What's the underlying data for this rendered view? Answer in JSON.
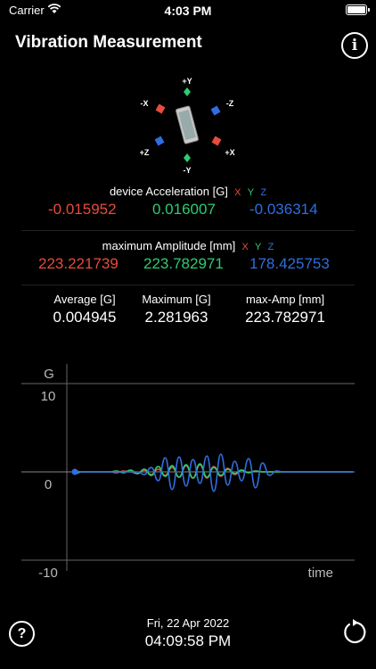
{
  "status_bar": {
    "carrier": "Carrier",
    "time": "4:03 PM"
  },
  "header": {
    "title": "Vibration Measurement",
    "info_icon": "info-icon"
  },
  "orientation": {
    "labels": {
      "py": "+Y",
      "ny": "-Y",
      "px": "+X",
      "nx": "-X",
      "pz": "+Z",
      "nz": "-Z"
    }
  },
  "acceleration": {
    "label": "device Acceleration [G]",
    "axes": {
      "x": "X",
      "y": "Y",
      "z": "Z"
    },
    "x": "-0.015952",
    "y": "0.016007",
    "z": "-0.036314"
  },
  "amplitude": {
    "label": "maximum Amplitude [mm]",
    "axes": {
      "x": "X",
      "y": "Y",
      "z": "Z"
    },
    "x": "223.221739",
    "y": "223.782971",
    "z": "178.425753"
  },
  "stats": {
    "average": {
      "label": "Average [G]",
      "value": "0.004945"
    },
    "maximum": {
      "label": "Maximum [G]",
      "value": "2.281963"
    },
    "max_amp": {
      "label": "max-Amp [mm]",
      "value": "223.782971"
    }
  },
  "chart_data": {
    "type": "line",
    "ylabel": "G",
    "xlabel": "time",
    "ylim": [
      -10,
      10
    ],
    "ytick_labels": [
      "10",
      "0",
      "-10"
    ],
    "colors": {
      "x": "#e74c3c",
      "y": "#2ecc71",
      "z": "#2f6ee0"
    },
    "x": [
      0,
      1,
      2,
      3,
      4,
      5,
      6,
      7,
      8,
      9,
      10,
      11,
      12,
      13,
      14,
      15,
      16,
      17,
      18,
      19,
      20,
      21,
      22,
      23,
      24,
      25,
      26,
      27,
      28,
      29,
      30,
      31,
      32,
      33,
      34,
      35,
      36,
      37,
      38,
      39,
      40
    ],
    "series": [
      {
        "name": "X",
        "values": [
          0.1,
          0,
          0,
          0,
          0,
          0,
          -0.1,
          0.1,
          0,
          -0.2,
          0.2,
          -0.3,
          0.3,
          -0.4,
          0.5,
          -0.6,
          0.7,
          -0.7,
          0.8,
          -0.7,
          0.6,
          -0.5,
          0.4,
          -0.3,
          0.2,
          -0.1,
          0.1,
          0,
          0,
          0,
          0,
          0,
          0,
          0,
          0,
          0,
          0,
          0,
          0,
          0,
          0
        ]
      },
      {
        "name": "Y",
        "values": [
          -0.2,
          0,
          0,
          0,
          0,
          0,
          0.1,
          -0.1,
          0.2,
          -0.2,
          0.3,
          -0.4,
          0.6,
          -0.5,
          0.7,
          -0.6,
          0.8,
          -0.7,
          0.9,
          -0.6,
          0.5,
          -0.4,
          0.3,
          -0.2,
          0.2,
          -0.1,
          0.1,
          0,
          0,
          0,
          0,
          0,
          0,
          0,
          0,
          0,
          0,
          0,
          0,
          0,
          0
        ]
      },
      {
        "name": "Z",
        "values": [
          0,
          0,
          0,
          0,
          0,
          0,
          0,
          0,
          0,
          0,
          -0.3,
          0.5,
          -1.0,
          1.6,
          -2.0,
          1.7,
          -1.6,
          1.4,
          -1.3,
          1.8,
          -2.2,
          2.0,
          -1.5,
          1.2,
          -1.0,
          1.5,
          -1.8,
          1.0,
          -0.4,
          0.1,
          0,
          0,
          0,
          0,
          0,
          0,
          0,
          0,
          0,
          0,
          0
        ]
      }
    ]
  },
  "footer": {
    "date": "Fri, 22 Apr 2022",
    "time": "04:09:58 PM"
  }
}
